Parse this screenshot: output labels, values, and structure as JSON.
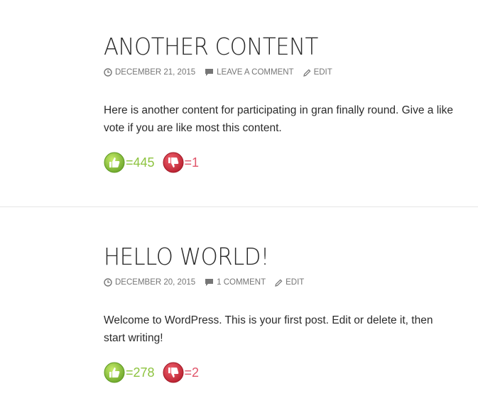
{
  "posts": [
    {
      "title": "ANOTHER CONTENT",
      "date": "DECEMBER 21, 2015",
      "comments": "LEAVE A COMMENT",
      "edit": "EDIT",
      "content": "Here is another content for participating in gran finally round. Give a like vote if you are like most this content.",
      "likes": "=445",
      "dislikes": "=1"
    },
    {
      "title": "HELLO WORLD!",
      "date": "DECEMBER 20, 2015",
      "comments": "1 COMMENT",
      "edit": "EDIT",
      "content": "Welcome to WordPress. This is your first post. Edit or delete it, then start writing!",
      "likes": "=278",
      "dislikes": "=2"
    }
  ],
  "icons": {
    "date": "clock-icon",
    "comments": "comment-bubble-icon",
    "edit": "pencil-icon",
    "like": "thumbs-up-icon",
    "dislike": "thumbs-down-icon"
  },
  "colors": {
    "like": "#8dc33f",
    "dislike": "#e0556a",
    "meta": "#767676",
    "text": "#2b2b2b"
  }
}
